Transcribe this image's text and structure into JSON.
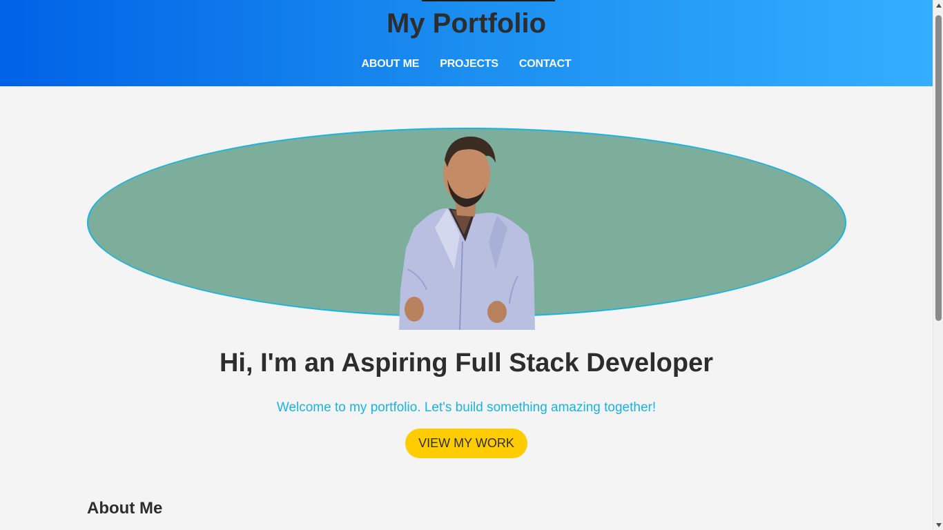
{
  "header": {
    "title": "My Portfolio",
    "nav": [
      {
        "label": "ABOUT ME"
      },
      {
        "label": "PROJECTS"
      },
      {
        "label": "CONTACT"
      }
    ]
  },
  "hero": {
    "photo_alt": "Profile photo",
    "heading": "Hi, I'm an Aspiring Full Stack Developer",
    "subtitle": "Welcome to my portfolio. Let's build something amazing together!",
    "cta_label": "VIEW MY WORK"
  },
  "about": {
    "title": "About Me"
  },
  "colors": {
    "header_gradient_start": "#0062e6",
    "header_gradient_end": "#33aeff",
    "oval_fill": "#7cae9b",
    "oval_border": "#17b3e5",
    "accent_text": "#17b3e5",
    "cta_background": "#ffcc00",
    "page_background": "#f4f4f4"
  },
  "scrollbar": {
    "up_icon": "triangle-up-icon",
    "down_icon": "triangle-down-icon"
  }
}
